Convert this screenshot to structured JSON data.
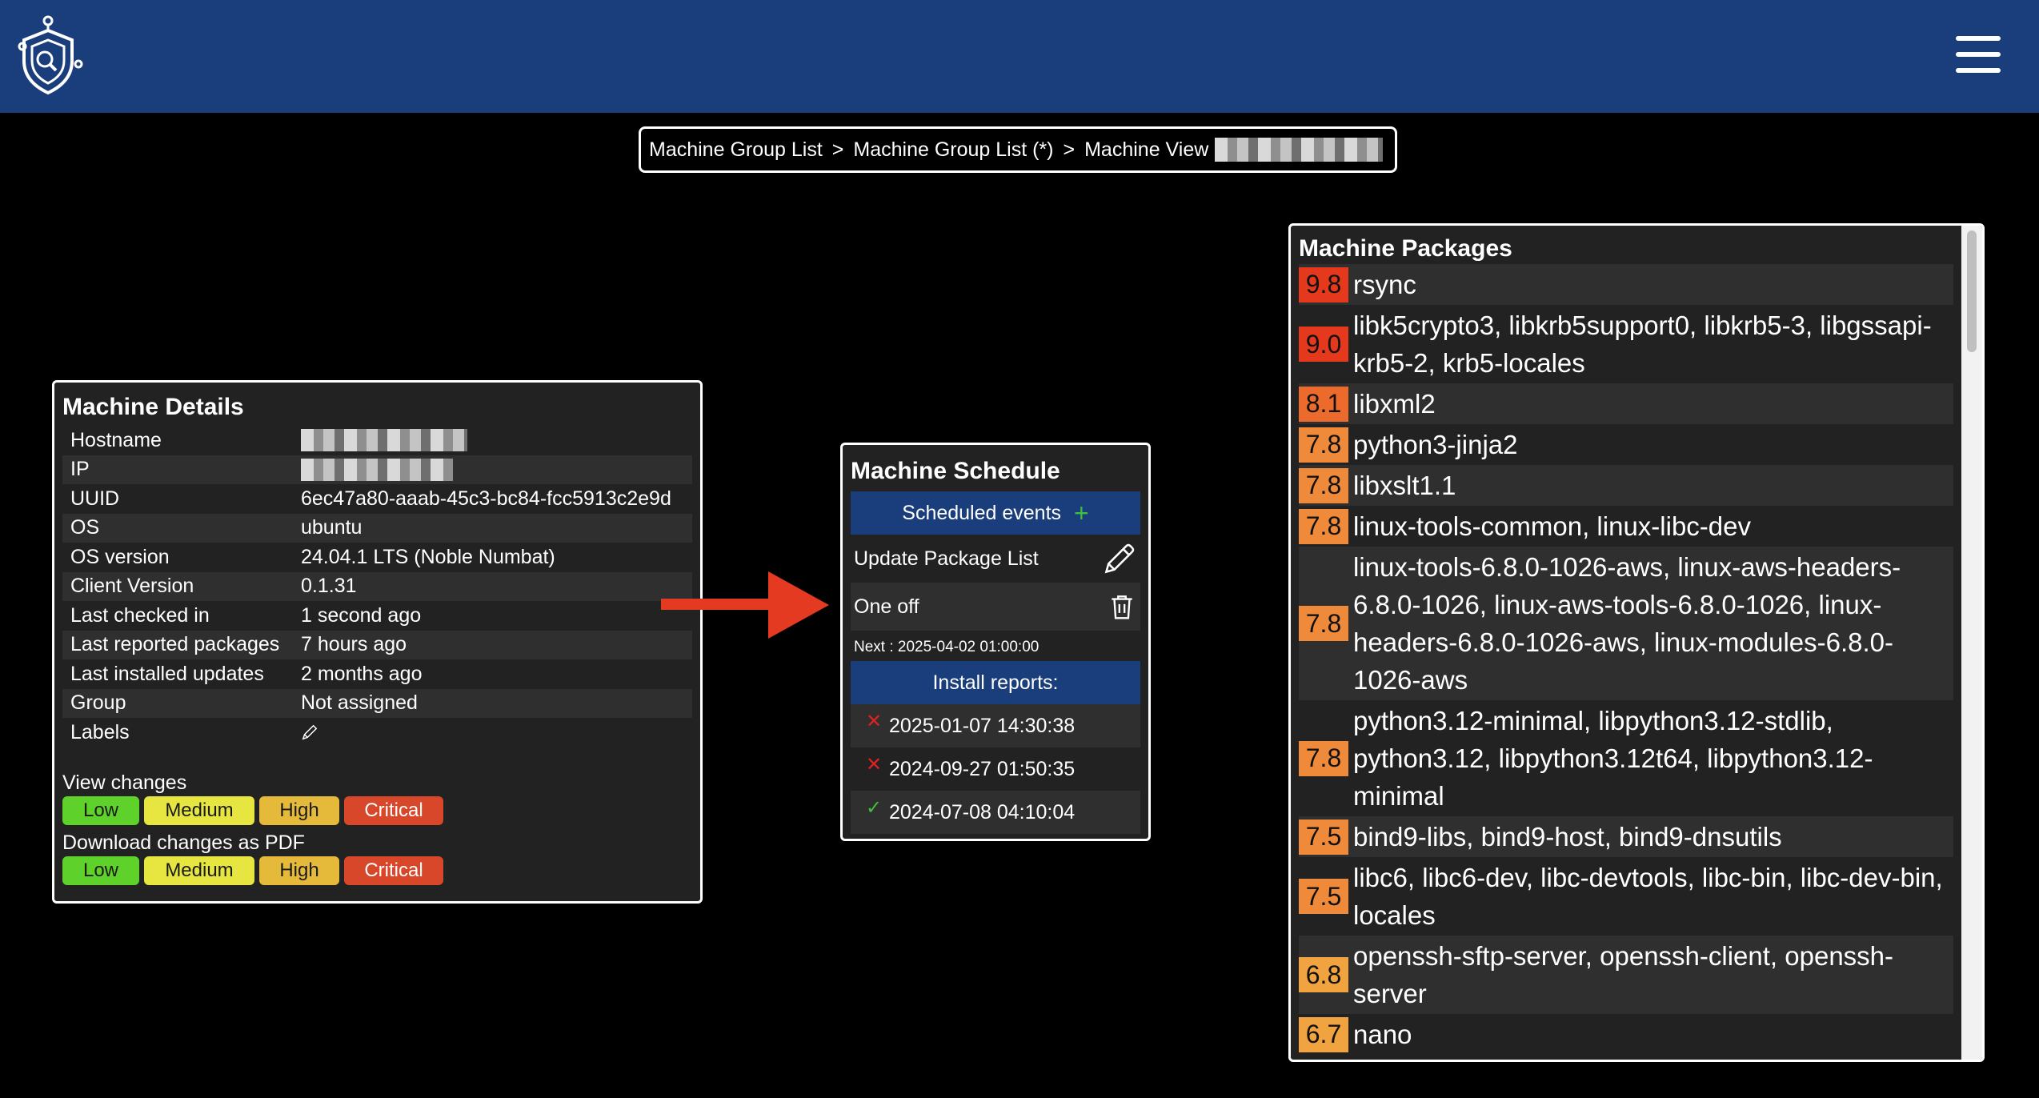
{
  "header": {
    "logo_icon": "shield-logo-icon",
    "menu_icon": "hamburger-menu-icon"
  },
  "breadcrumb": {
    "items": [
      "Machine Group List",
      "Machine Group List (*)",
      "Machine View"
    ],
    "separator": ">"
  },
  "details": {
    "title": "Machine Details",
    "rows": [
      {
        "key": "Hostname",
        "value": ""
      },
      {
        "key": "IP",
        "value": ""
      },
      {
        "key": "UUID",
        "value": "6ec47a80-aaab-45c3-bc84-fcc5913c2e9d"
      },
      {
        "key": "OS",
        "value": "ubuntu"
      },
      {
        "key": "OS version",
        "value": "24.04.1 LTS (Noble Numbat)"
      },
      {
        "key": "Client Version",
        "value": "0.1.31"
      },
      {
        "key": "Last checked in",
        "value": "1 second ago"
      },
      {
        "key": "Last reported packages",
        "value": "7 hours ago"
      },
      {
        "key": "Last installed updates",
        "value": "2 months ago"
      },
      {
        "key": "Group",
        "value": "Not assigned"
      },
      {
        "key": "Labels",
        "value": ""
      }
    ],
    "view_changes_label": "View changes",
    "download_label": "Download changes as PDF",
    "severity": {
      "low": "Low",
      "medium": "Medium",
      "high": "High",
      "critical": "Critical"
    }
  },
  "schedule": {
    "title": "Machine Schedule",
    "scheduled_events_label": "Scheduled events",
    "add_symbol": "+",
    "job_name": "Update Package List",
    "job_type": "One off",
    "next_run": "Next : 2025-04-02 01:00:00",
    "install_reports_label": "Install reports:",
    "reports": [
      {
        "date": "2025-01-07 14:30:38",
        "status": "failed",
        "mark": "✕"
      },
      {
        "date": "2024-09-27 01:50:35",
        "status": "failed",
        "mark": "✕"
      },
      {
        "date": "2024-07-08 04:10:04",
        "status": "success",
        "mark": "✓"
      }
    ]
  },
  "packages": {
    "title": "Machine Packages",
    "items": [
      {
        "score": "9.8",
        "color": "#e5391d",
        "names": "rsync"
      },
      {
        "score": "9.0",
        "color": "#e5391d",
        "names": "libk5crypto3, libkrb5support0, libkrb5-3, libgssapi-krb5-2, krb5-locales"
      },
      {
        "score": "8.1",
        "color": "#ec6a2c",
        "names": "libxml2"
      },
      {
        "score": "7.8",
        "color": "#ef8a3a",
        "names": "python3-jinja2"
      },
      {
        "score": "7.8",
        "color": "#ef8a3a",
        "names": "libxslt1.1"
      },
      {
        "score": "7.8",
        "color": "#ef8a3a",
        "names": "linux-tools-common, linux-libc-dev"
      },
      {
        "score": "7.8",
        "color": "#ef8a3a",
        "names": "linux-tools-6.8.0-1026-aws, linux-aws-headers-6.8.0-1026, linux-aws-tools-6.8.0-1026, linux-headers-6.8.0-1026-aws, linux-modules-6.8.0-1026-aws"
      },
      {
        "score": "7.8",
        "color": "#ef8a3a",
        "names": "python3.12-minimal, libpython3.12-stdlib, python3.12, libpython3.12t64, libpython3.12-minimal"
      },
      {
        "score": "7.5",
        "color": "#ef8a3a",
        "names": "bind9-libs, bind9-host, bind9-dnsutils"
      },
      {
        "score": "7.5",
        "color": "#ef8a3a",
        "names": "libc6, libc6-dev, libc-devtools, libc-bin, libc-dev-bin, locales"
      },
      {
        "score": "6.8",
        "color": "#f0a33e",
        "names": "openssh-sftp-server, openssh-client, openssh-server"
      },
      {
        "score": "6.7",
        "color": "#f0a33e",
        "names": "nano"
      }
    ]
  }
}
